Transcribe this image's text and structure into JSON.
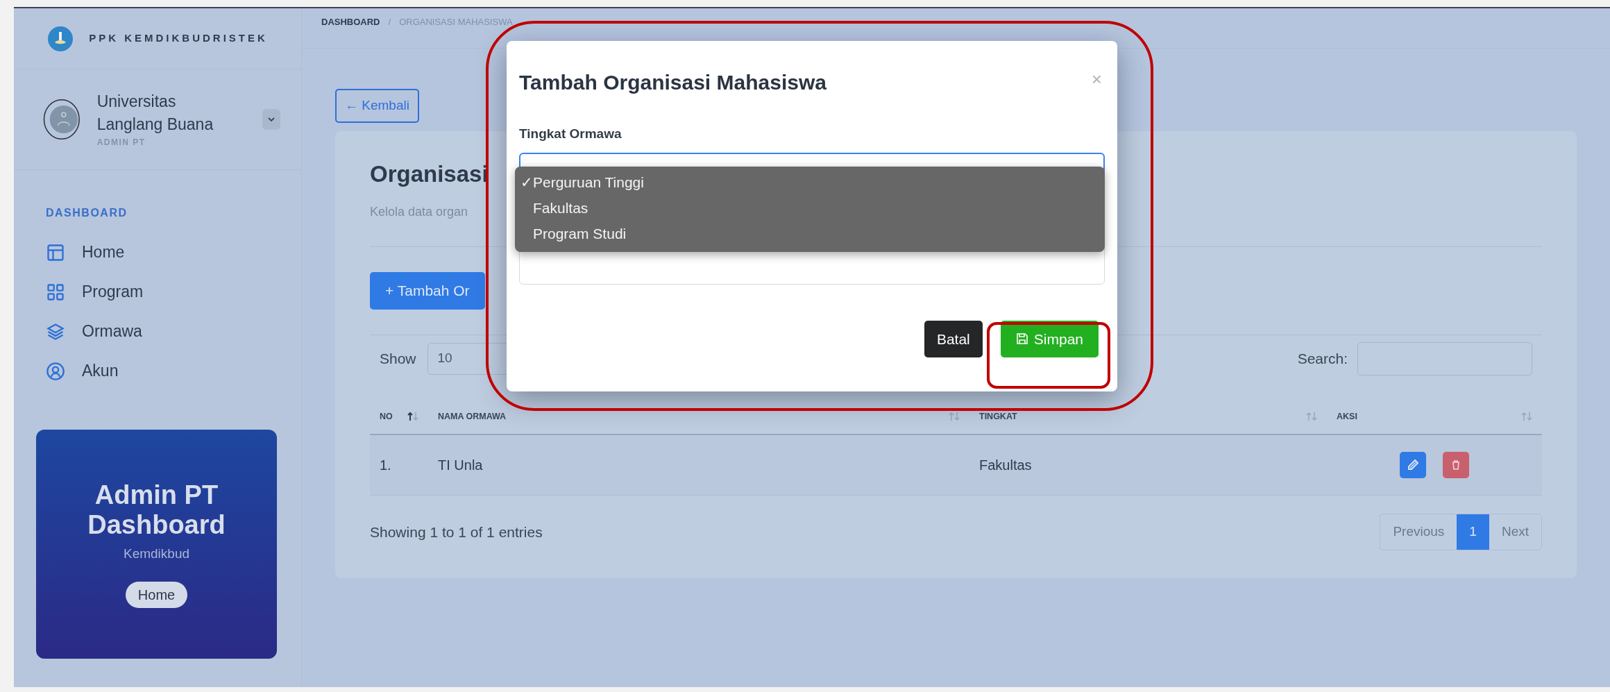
{
  "sidebar": {
    "brand": "PPK KEMDIKBUDRISTEK",
    "profile": {
      "name": "Universitas Langlang Buana",
      "role": "ADMIN PT"
    },
    "section": "DASHBOARD",
    "items": [
      {
        "label": "Home"
      },
      {
        "label": "Program"
      },
      {
        "label": "Ormawa"
      },
      {
        "label": "Akun"
      }
    ],
    "promo": {
      "title": "Admin PT Dashboard",
      "subtitle": "Kemdikbud",
      "button": "Home"
    }
  },
  "breadcrumb": {
    "items": [
      "DASHBOARD",
      "ORGANISASI MAHASISWA"
    ],
    "separator": "/"
  },
  "back_button": "← Kembali",
  "page": {
    "title": "Organisasi",
    "subtitle": "Kelola data organ",
    "add_button": "+ Tambah Or"
  },
  "table_controls": {
    "show_label": "Show",
    "page_length": "10",
    "search_label": "Search:"
  },
  "table": {
    "columns": [
      {
        "label": "NO",
        "sorted": true
      },
      {
        "label": "NAMA ORMAWA",
        "sorted": false
      },
      {
        "label": "TINGKAT",
        "sorted": false
      },
      {
        "label": "AKSI",
        "sorted": false
      }
    ],
    "rows": [
      {
        "no": "1.",
        "name": "TI Unla",
        "tingkat": "Fakultas"
      }
    ]
  },
  "footer": {
    "info": "Showing 1 to 1 of 1 entries",
    "pagination": [
      {
        "label": "Previous",
        "selected": false
      },
      {
        "label": "1",
        "selected": true
      },
      {
        "label": "Next",
        "selected": false
      }
    ]
  },
  "modal": {
    "title": "Tambah Organisasi Mahasiswa",
    "close": "×",
    "field_label": "Tingkat Ormawa",
    "check_mark": "✓",
    "options": [
      {
        "label": "Perguruan Tinggi",
        "selected": true
      },
      {
        "label": "Fakultas",
        "selected": false
      },
      {
        "label": "Program Studi",
        "selected": false
      }
    ],
    "buttons": [
      {
        "label": "Batal",
        "kind": "secondary"
      },
      {
        "label": "Simpan",
        "kind": "primary"
      }
    ]
  }
}
